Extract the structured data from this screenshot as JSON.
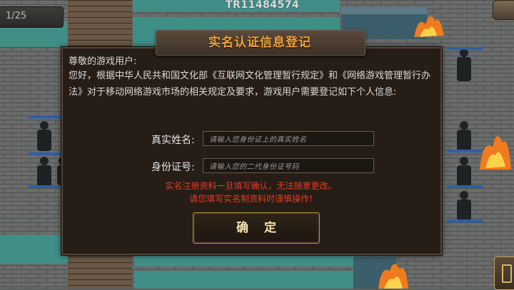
{
  "watermark": "TR11484574",
  "pager": {
    "text": "1/25"
  },
  "dialog": {
    "title": "实名认证信息登记",
    "greeting": "尊敬的游戏用户:",
    "body": "您好，根据中华人民共和国文化部《互联网文化管理暂行规定》和《网络游戏管理暂行办法》对于移动网络游戏市场的相关规定及要求，游戏用户需要登记如下个人信息:",
    "name_label": "真实姓名:",
    "name_placeholder": "请输入您身份证上的真实姓名",
    "id_label": "身份证号:",
    "id_placeholder": "请输入您的二代身份证号码",
    "warning_1": "实名注册资料一旦填写确认，无法随意更改。",
    "warning_2": "请您填写实名制资料时谨慎操作!",
    "confirm_label": "确定"
  },
  "colors": {
    "title": "#f2a23a",
    "warning": "#e43a22",
    "panel": "#271d17",
    "water": "#3f8f87"
  }
}
